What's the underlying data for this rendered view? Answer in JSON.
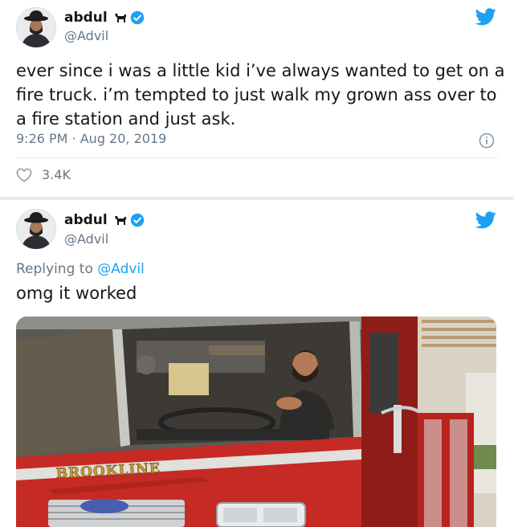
{
  "tweet1": {
    "author_name": "abdul",
    "author_handle": "@Advil",
    "text": "ever since i was a little kid i’ve always wanted to get on a fire truck. i’m tempted to just walk my grown ass over to a fire station and just ask.",
    "timestamp": "9:26 PM · Aug 20, 2019",
    "likes": "3.4K"
  },
  "tweet2": {
    "author_name": "abdul",
    "author_handle": "@Advil",
    "replying_prefix": "Replying to ",
    "replying_to": "@Advil",
    "text": "omg it worked",
    "photo_text": "BROOKLINE"
  },
  "colors": {
    "twitter_blue": "#1da1f2",
    "secondary_text": "#657786",
    "truck_red": "#c62a24"
  }
}
